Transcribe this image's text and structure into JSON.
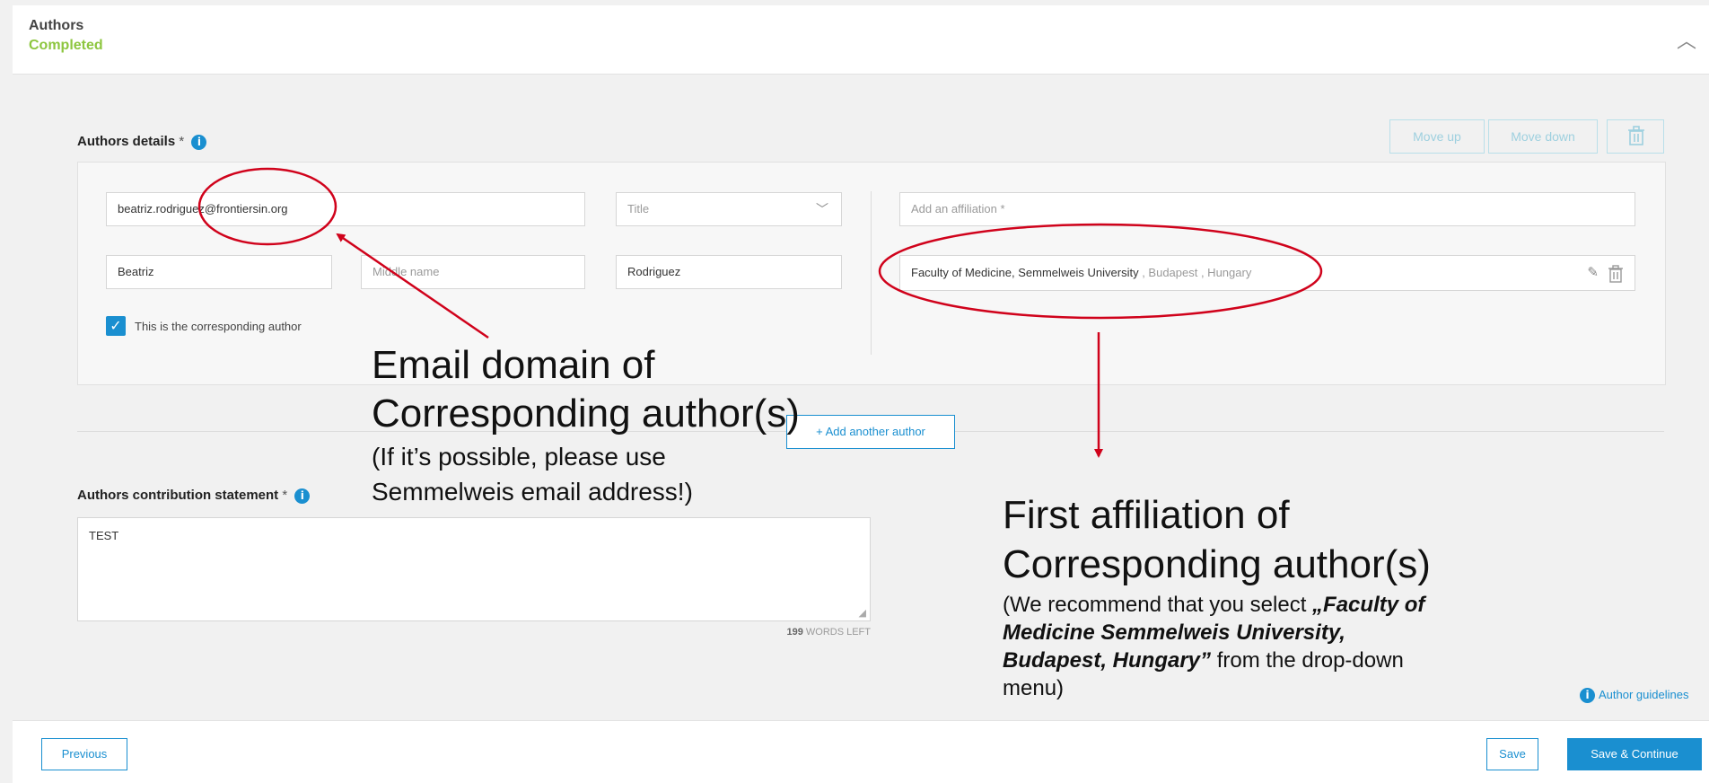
{
  "header": {
    "title": "Authors",
    "status": "Completed"
  },
  "authors_details": {
    "label": "Authors details",
    "required_mark": "*",
    "move_up": "Move up",
    "move_down": "Move down",
    "email": "beatriz.rodriguez@frontiersin.org",
    "title_placeholder": "Title",
    "first_name": "Beatriz",
    "middle_name_placeholder": "Middle name",
    "last_name": "Rodriguez",
    "affiliation_placeholder": "Add an affiliation *",
    "affiliation_main": "Faculty of Medicine, Semmelweis University",
    "affiliation_location": " , Budapest , Hungary",
    "corresponding_label": "This is the corresponding author"
  },
  "add_author_label": "+ Add another author",
  "contribution": {
    "label": "Authors contribution statement",
    "required_mark": "*",
    "text": "TEST",
    "words_count": "199",
    "words_suffix": "WORDS LEFT"
  },
  "author_guidelines": "Author guidelines",
  "footer": {
    "previous": "Previous",
    "save": "Save",
    "save_continue": "Save & Continue"
  },
  "annotations": {
    "email_line1": "Email domain of",
    "email_line2": "Corresponding author(s)",
    "email_note1": "(If it’s possible, please use",
    "email_note2": "Semmelweis email address!)",
    "aff_line1": "First affiliation of",
    "aff_line2": "Corresponding author(s)",
    "aff_note_prefix": "(We recommend that you select ",
    "aff_note_bold1": "„Faculty of",
    "aff_note_bold2": "Medicine Semmelweis University,",
    "aff_note_bold3": "Budapest, Hungary”",
    "aff_note_suffix": " from the drop-down",
    "aff_note_end": "menu)"
  },
  "colors": {
    "accent": "#1a8fd0",
    "completed": "#8dc63f",
    "annotation": "#d0021b"
  }
}
